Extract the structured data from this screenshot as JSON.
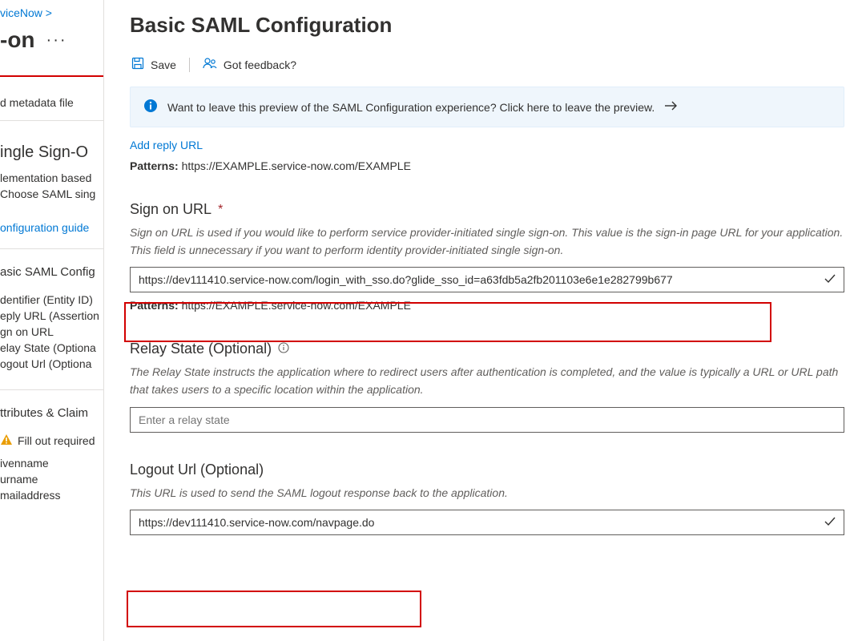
{
  "left": {
    "breadcrumb": "viceNow  >",
    "title": "-on",
    "metadata_link": "d metadata file",
    "section1_title": "ingle Sign-O",
    "impl_text1": "lementation based",
    "impl_text2": "Choose SAML sing",
    "config_guide": "onfiguration guide",
    "section2_title": "asic SAML Config",
    "items": [
      "dentifier (Entity ID)",
      "eply URL (Assertion",
      "gn on URL",
      "elay State (Optiona",
      "ogout Url (Optiona"
    ],
    "section3_title": "ttributes & Claim",
    "warn_text": "Fill out required",
    "attrs": [
      "ivenname",
      "urname",
      "mailaddress"
    ]
  },
  "main": {
    "title": "Basic SAML Configuration",
    "save": "Save",
    "feedback": "Got feedback?",
    "info_text": "Want to leave this preview of the SAML Configuration experience? Click here to leave the preview.",
    "add_reply": "Add reply URL",
    "patterns_label": "Patterns:",
    "patterns_url": "https://EXAMPLE.service-now.com/EXAMPLE",
    "signon": {
      "label": "Sign on URL",
      "desc": "Sign on URL is used if you would like to perform service provider-initiated single sign-on. This value is the sign-in page URL for your application. This field is unnecessary if you want to perform identity provider-initiated single sign-on.",
      "value": "https://dev111410.service-now.com/login_with_sso.do?glide_sso_id=a63fdb5a2fb201103e6e1e282799b677"
    },
    "relay": {
      "label": "Relay State (Optional)",
      "desc": "The Relay State instructs the application where to redirect users after authentication is completed, and the value is typically a URL or URL path that takes users to a specific location within the application.",
      "placeholder": "Enter a relay state"
    },
    "logout": {
      "label": "Logout Url (Optional)",
      "desc": "This URL is used to send the SAML logout response back to the application.",
      "value": "https://dev111410.service-now.com/navpage.do"
    }
  }
}
